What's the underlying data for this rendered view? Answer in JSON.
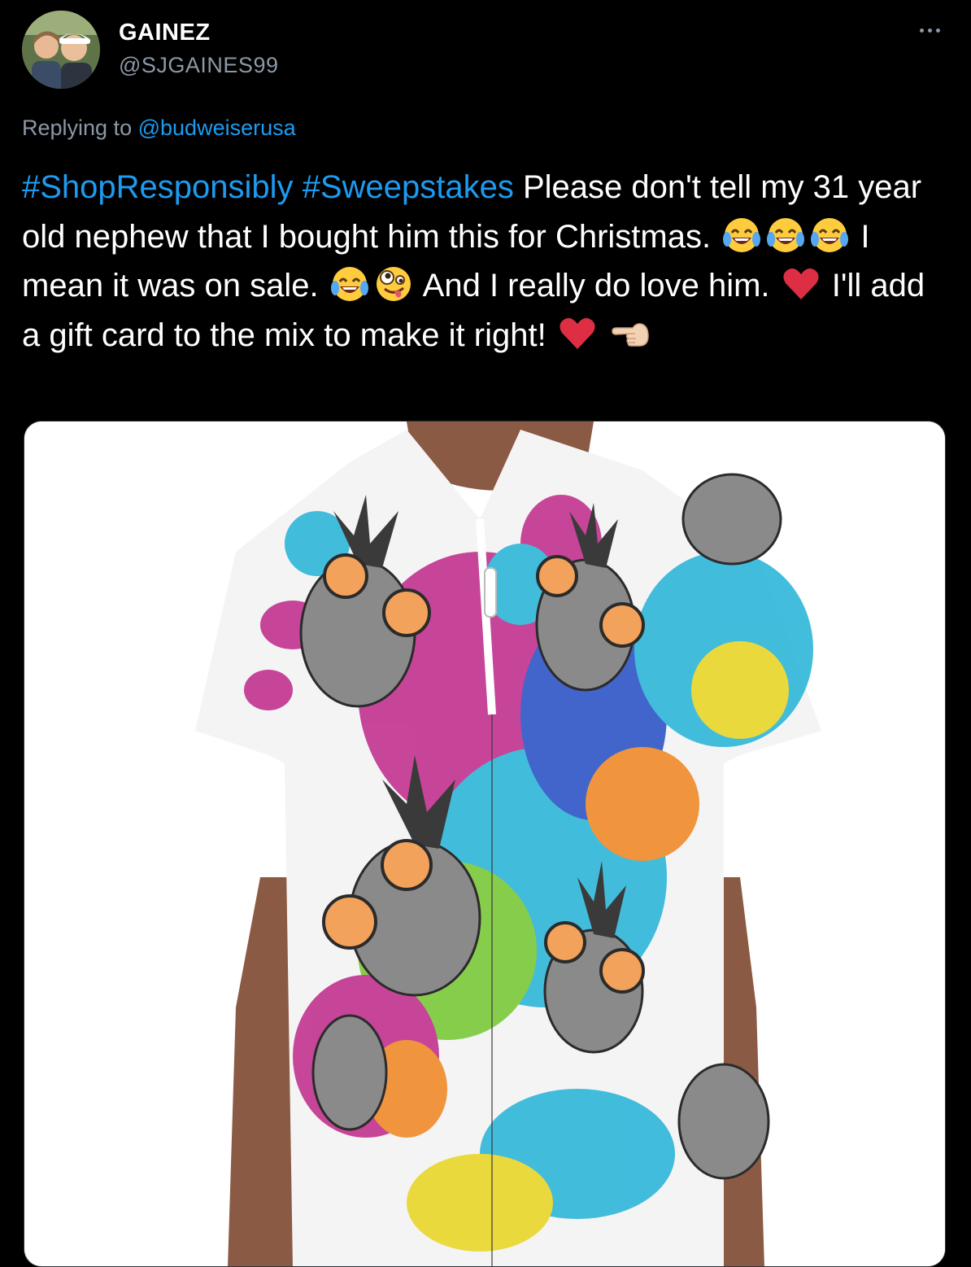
{
  "author": {
    "display_name": "GAINEZ",
    "handle": "@SJGAINES99",
    "avatar_icon": "avatar-photo"
  },
  "more_icon": "more-horizontal-icon",
  "reply": {
    "prefix": "Replying to",
    "mention": "@budweiserusa"
  },
  "tweet": {
    "hashtag_1": "#ShopResponsibly",
    "hashtag_2": "#Sweepstakes",
    "text_1": " Please don't tell my 31 year old nephew that I bought him this for Christmas. ",
    "text_2": " I mean it was on sale. ",
    "text_3": " And I really do love him. ",
    "text_4": " I'll add a gift card to the mix to make it right! ",
    "emojis": [
      "laughing-tears",
      "laughing-tears",
      "laughing-tears",
      "laughing-tears",
      "zany-face",
      "red-heart",
      "red-heart",
      "pointing-left-hand"
    ]
  },
  "media": {
    "kind": "photo",
    "subject": "shirt-image",
    "colors": {
      "magenta": "#c2338f",
      "cyan": "#2fb6d9",
      "yellow": "#e9d72a",
      "orange": "#f08a2b",
      "blue": "#2f56c8",
      "green": "#7cc93a",
      "skin": "#8b5a44"
    }
  },
  "colors": {
    "background": "#000000",
    "text": "#ffffff",
    "secondary": "#8b98a5",
    "link": "#1d9bf0"
  }
}
